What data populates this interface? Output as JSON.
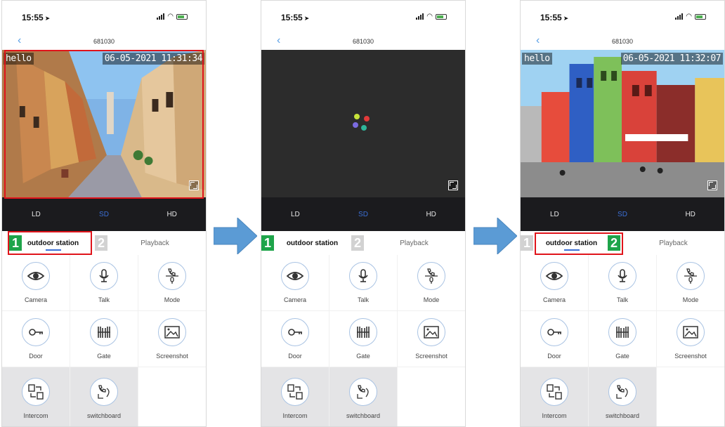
{
  "screens": [
    {
      "status": {
        "time": "15:55"
      },
      "nav": {
        "back": "‹",
        "title": "681030"
      },
      "video": {
        "state": "live",
        "osd_name": "hello",
        "osd_timestamp": "06-05-2021 11:31:34"
      },
      "quality": [
        "LD",
        "SD",
        "HD"
      ],
      "quality_active": "SD",
      "tabs": {
        "outdoor": "outdoor station",
        "playback": "Playback",
        "step_a": "1",
        "step_b": "2"
      },
      "actions": [
        "Camera",
        "Talk",
        "Mode",
        "Door",
        "Gate",
        "Screenshot",
        "Intercom",
        "switchboard"
      ]
    },
    {
      "status": {
        "time": "15:55"
      },
      "nav": {
        "back": "‹",
        "title": "681030"
      },
      "video": {
        "state": "loading",
        "osd_name": "",
        "osd_timestamp": ""
      },
      "quality": [
        "LD",
        "SD",
        "HD"
      ],
      "quality_active": "SD",
      "tabs": {
        "outdoor": "outdoor station",
        "playback": "Playback",
        "step_a": "1",
        "step_b": "2"
      },
      "actions": [
        "Camera",
        "Talk",
        "Mode",
        "Door",
        "Gate",
        "Screenshot",
        "Intercom",
        "switchboard"
      ]
    },
    {
      "status": {
        "time": "15:55"
      },
      "nav": {
        "back": "‹",
        "title": "681030"
      },
      "video": {
        "state": "live",
        "osd_name": "hello",
        "osd_timestamp": "06-05-2021 11:32:07"
      },
      "quality": [
        "LD",
        "SD",
        "HD"
      ],
      "quality_active": "SD",
      "tabs": {
        "outdoor": "outdoor station",
        "playback": "Playback",
        "step_a": "1",
        "step_b": "2"
      },
      "actions": [
        "Camera",
        "Talk",
        "Mode",
        "Door",
        "Gate",
        "Screenshot",
        "Intercom",
        "switchboard"
      ]
    }
  ],
  "icons": [
    "eye-icon",
    "microphone-icon",
    "phone-mic-icon",
    "key-icon",
    "gate-icon",
    "screenshot-icon",
    "intercom-icon",
    "switchboard-icon"
  ],
  "colors": {
    "accent": "#3b6fd6",
    "highlight": "#e0141b",
    "step_active": "#1ea44a",
    "step_inactive": "#d2d2d2",
    "arrow": "#5b9bd5"
  }
}
